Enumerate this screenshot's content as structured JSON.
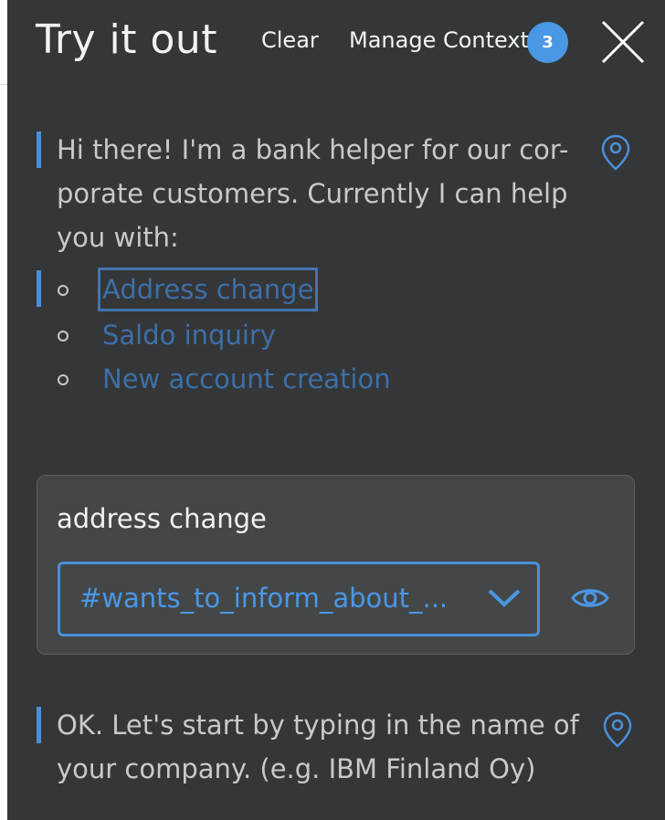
{
  "header": {
    "title": "Try it out",
    "clear_label": "Clear",
    "manage_context_label": "Manage Context",
    "context_count": "3"
  },
  "messages": [
    {
      "lines": [
        "Hi there! I'm a bank helper for our cor-",
        "porate customers. Currently I can help",
        "you with:"
      ]
    },
    {
      "lines": [
        "OK. Let's start by typing in the name of",
        "your company. (e.g. IBM Finland Oy)"
      ]
    }
  ],
  "options": [
    {
      "label": "Address change",
      "focused": true
    },
    {
      "label": "Saldo inquiry",
      "focused": false
    },
    {
      "label": "New account creation",
      "focused": false
    }
  ],
  "user_input": {
    "text": "address change",
    "intent_value": "#wants_to_inform_about_..."
  },
  "icons": {
    "close": "close-icon",
    "pin": "location-pin-icon",
    "eye": "eye-icon",
    "chevron": "chevron-down-icon"
  },
  "colors": {
    "panel_bg": "#353637",
    "accent": "#4a97e5",
    "link": "#3d6fa8",
    "card_bg": "#444748"
  }
}
